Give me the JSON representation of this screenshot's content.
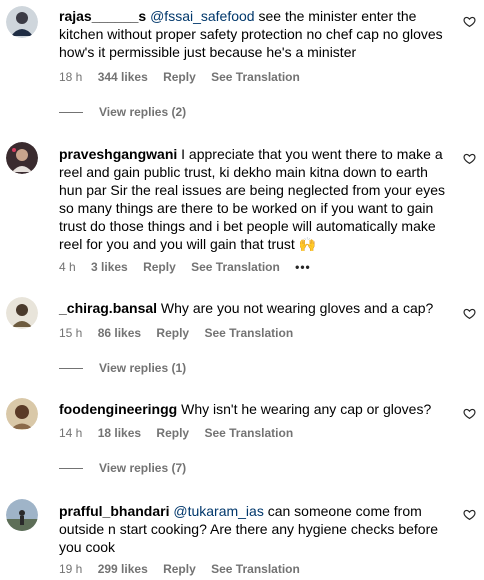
{
  "comments": [
    {
      "username": "rajas______s",
      "mention": "@fssai_safefood",
      "text": " see the minister enter the kitchen without proper safety protection no chef cap no gloves how's it permissible just because he's a minister",
      "time": "18 h",
      "likes": "344 likes",
      "reply": "Reply",
      "translate": "See Translation",
      "view_replies": "View replies (2)"
    },
    {
      "username": "praveshgangwani",
      "mention": "",
      "text": " I appreciate that you went there to make a reel and gain public trust, ki dekho main kitna down to earth hun par Sir the real issues are being neglected from your eyes so many things are there to be worked on if you want to gain trust do those things and i bet people will automatically make reel for you and you will gain that trust 🙌",
      "time": "4 h",
      "likes": "3 likes",
      "reply": "Reply",
      "translate": "See Translation",
      "more": "•••"
    },
    {
      "username": "_chirag.bansal",
      "mention": "",
      "text": " Why are you not wearing gloves and a cap?",
      "time": "15 h",
      "likes": "86 likes",
      "reply": "Reply",
      "translate": "See Translation",
      "view_replies": "View replies (1)"
    },
    {
      "username": "foodengineeringg",
      "mention": "",
      "text": " Why isn't he wearing any cap or gloves?",
      "time": "14 h",
      "likes": "18 likes",
      "reply": "Reply",
      "translate": "See Translation",
      "view_replies": "View replies (7)"
    },
    {
      "username": "prafful_bhandari",
      "mention": "@tukaram_ias",
      "text": " can someone come from outside n start cooking? Are there any hygiene checks before you cook",
      "time": "19 h",
      "likes": "299 likes",
      "reply": "Reply",
      "translate": "See Translation"
    }
  ],
  "colors": {
    "meta": "#737373",
    "mention": "#00376b"
  },
  "icons": {
    "like": "heart-outline-icon",
    "more": "more-options-icon"
  }
}
